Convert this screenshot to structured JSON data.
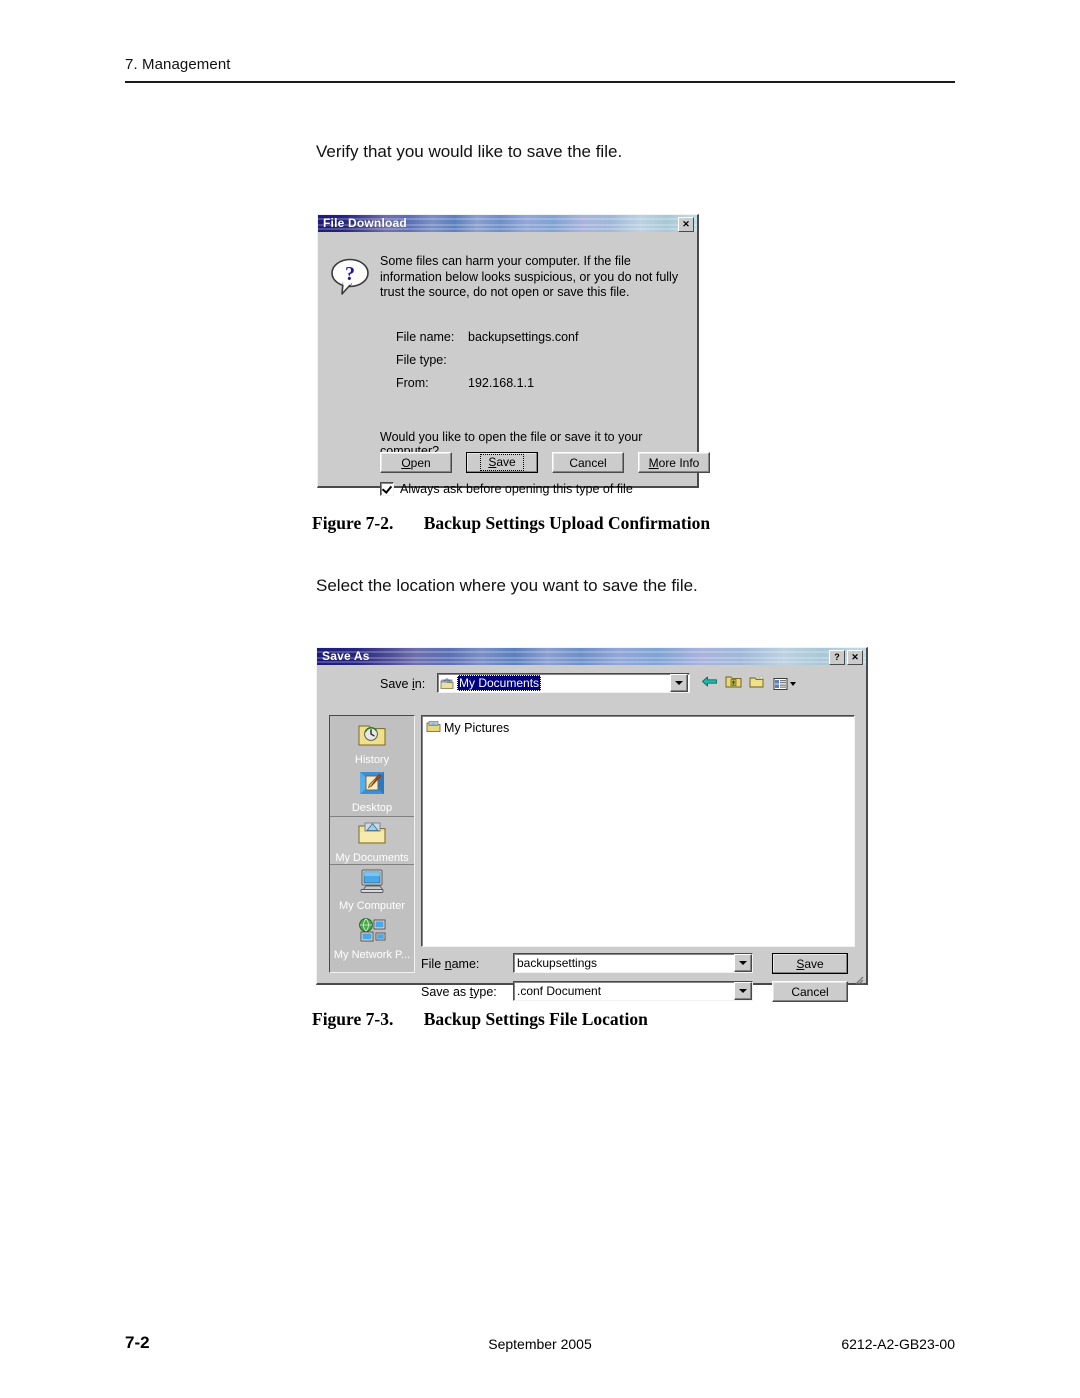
{
  "page": {
    "header_text": "7. Management",
    "footer": {
      "page_number": "7-2",
      "date": "September 2005",
      "doc_number": "6212-A2-GB23-00"
    }
  },
  "content": {
    "intro_1": "Verify that you would like to save the file.",
    "intro_2": "Select the location where you want to save the file.",
    "caption_1": {
      "number": "Figure 7-2.",
      "title": "Backup Settings Upload Confirmation"
    },
    "caption_2": {
      "number": "Figure 7-3.",
      "title": "Backup Settings File Location"
    }
  },
  "file_download_dialog": {
    "title": "File Download",
    "close_label": "✕",
    "warning_text": "Some files can harm your computer. If the file information below looks suspicious, or you do not fully trust the source, do not open or save this file.",
    "fields": [
      {
        "label": "File name:",
        "value": "backupsettings.conf"
      },
      {
        "label": "File type:",
        "value": ""
      },
      {
        "label": "From:",
        "value": "192.168.1.1"
      }
    ],
    "question": "Would you like to open the file or save it to your computer?",
    "buttons": {
      "open": "Open",
      "save": "Save",
      "cancel": "Cancel",
      "more_info": "More Info"
    },
    "checkbox": {
      "label": "Always ask before opening this type of file",
      "checked": true
    }
  },
  "save_as_dialog": {
    "title": "Save As",
    "help_label": "?",
    "close_label": "✕",
    "save_in_label": "Save in:",
    "save_in_value": "My Documents",
    "toolbar_icons": [
      "back-arrow-icon",
      "up-one-level-icon",
      "new-folder-icon",
      "views-menu-icon"
    ],
    "places": [
      {
        "label": "History",
        "icon": "history-folder-icon",
        "selected": false
      },
      {
        "label": "Desktop",
        "icon": "desktop-icon",
        "selected": false
      },
      {
        "label": "My Documents",
        "icon": "my-documents-icon",
        "selected": true
      },
      {
        "label": "My Computer",
        "icon": "my-computer-icon",
        "selected": false
      },
      {
        "label": "My Network P...",
        "icon": "my-network-places-icon",
        "selected": false
      }
    ],
    "files": [
      {
        "name": "My Pictures",
        "icon": "folder-icon"
      }
    ],
    "file_name_label": "File name:",
    "file_name_value": "backupsettings",
    "save_as_type_label": "Save as type:",
    "save_as_type_value": ".conf Document",
    "buttons": {
      "save": "Save",
      "cancel": "Cancel"
    }
  }
}
